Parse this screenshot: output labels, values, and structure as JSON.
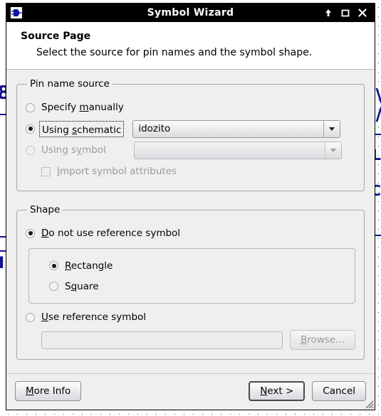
{
  "window": {
    "title": "Symbol Wizard",
    "icon": "chip-symbol-icon",
    "controls": [
      {
        "name": "shade-button",
        "glyph": "↑"
      },
      {
        "name": "maximize-button",
        "glyph": "□"
      },
      {
        "name": "close-button",
        "glyph": "✕"
      }
    ]
  },
  "header": {
    "title": "Source Page",
    "subtitle": "Select the source for pin names and the symbol shape."
  },
  "pin_name_source": {
    "legend": "Pin name source",
    "options": [
      {
        "label_before": "Specify ",
        "mnemonic": "m",
        "label_after": "anually",
        "selected": false,
        "disabled": false,
        "focused": false
      },
      {
        "label_before": "Using ",
        "mnemonic": "s",
        "label_after": "chematic",
        "selected": true,
        "disabled": false,
        "focused": true
      },
      {
        "label_before": "Using s",
        "mnemonic": "y",
        "label_after": "mbol",
        "selected": false,
        "disabled": true,
        "focused": false
      }
    ],
    "schematic_combo": {
      "value": "idozito",
      "disabled": false
    },
    "symbol_combo": {
      "value": "",
      "disabled": true
    },
    "import_checkbox": {
      "label_before": "",
      "mnemonic": "I",
      "label_after": "mport symbol attributes",
      "checked": false,
      "disabled": true
    }
  },
  "shape": {
    "legend": "Shape",
    "no_reference": {
      "label_before": "",
      "mnemonic": "D",
      "label_after": "o not use reference symbol",
      "selected": true
    },
    "sub_options": [
      {
        "label_before": "",
        "mnemonic": "R",
        "label_after": "ectangle",
        "selected": true
      },
      {
        "label_before": "S",
        "mnemonic": "q",
        "label_after": "uare",
        "selected": false
      }
    ],
    "use_reference": {
      "label_before": "",
      "mnemonic": "U",
      "label_after": "se reference symbol",
      "selected": false
    },
    "reference_path": {
      "value": "",
      "disabled": true
    },
    "browse_button": {
      "label_before": "",
      "mnemonic": "B",
      "label_after": "rowse...",
      "disabled": true
    }
  },
  "footer": {
    "more_info": {
      "label_before": "",
      "mnemonic": "M",
      "label_after": "ore Info"
    },
    "next": {
      "label_before": "",
      "mnemonic": "N",
      "label_after": "ext >",
      "is_default": true
    },
    "cancel": {
      "label": "Cancel"
    }
  },
  "colors": {
    "dialog_background": "#efefef",
    "titlebar_background": "#000000",
    "titlebar_text": "#ffffff",
    "header_background": "#ffffff",
    "schematic_blue": "#10108c",
    "disabled_text": "#9a9a9a"
  }
}
